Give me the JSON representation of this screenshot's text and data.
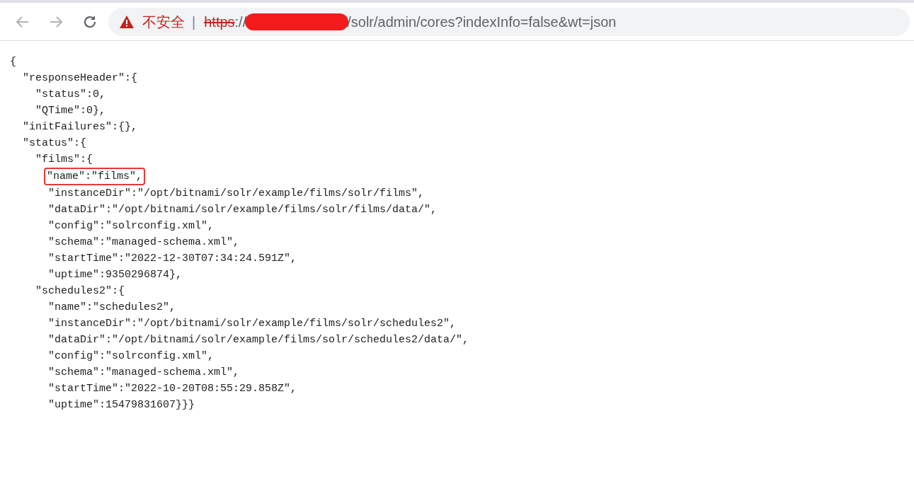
{
  "toolbar": {
    "security_label": "不安全",
    "separator": "|",
    "url": {
      "scheme": "https",
      "scheme_insecure": true,
      "delimiter": "://",
      "redacted": true,
      "path": "/solr/admin/cores?indexInfo=false&wt=json"
    }
  },
  "document": {
    "lines": [
      {
        "text": "{",
        "highlighted": false,
        "children": [
          {
            "text": "\"responseHeader\":{",
            "highlighted": false,
            "children": [
              {
                "text": "\"status\":0,",
                "highlighted": false
              },
              {
                "text": "\"QTime\":0},",
                "highlighted": false
              }
            ]
          },
          {
            "text": "\"initFailures\":{},",
            "highlighted": false
          },
          {
            "text": "\"status\":{",
            "highlighted": false,
            "children": [
              {
                "text": "\"films\":{",
                "highlighted": false,
                "children": [
                  {
                    "text": "\"name\":\"films\",",
                    "highlighted": true
                  },
                  {
                    "text": "\"instanceDir\":\"/opt/bitnami/solr/example/films/solr/films\",",
                    "highlighted": false
                  },
                  {
                    "text": "\"dataDir\":\"/opt/bitnami/solr/example/films/solr/films/data/\",",
                    "highlighted": false
                  },
                  {
                    "text": "\"config\":\"solrconfig.xml\",",
                    "highlighted": false
                  },
                  {
                    "text": "\"schema\":\"managed-schema.xml\",",
                    "highlighted": false
                  },
                  {
                    "text": "\"startTime\":\"2022-12-30T07:34:24.591Z\",",
                    "highlighted": false
                  },
                  {
                    "text": "\"uptime\":9350296874},",
                    "highlighted": false
                  }
                ]
              },
              {
                "text": "\"schedules2\":{",
                "highlighted": false,
                "children": [
                  {
                    "text": "\"name\":\"schedules2\",",
                    "highlighted": false
                  },
                  {
                    "text": "\"instanceDir\":\"/opt/bitnami/solr/example/films/solr/schedules2\",",
                    "highlighted": false
                  },
                  {
                    "text": "\"dataDir\":\"/opt/bitnami/solr/example/films/solr/schedules2/data/\",",
                    "highlighted": false
                  },
                  {
                    "text": "\"config\":\"solrconfig.xml\",",
                    "highlighted": false
                  },
                  {
                    "text": "\"schema\":\"managed-schema.xml\",",
                    "highlighted": false
                  },
                  {
                    "text": "\"startTime\":\"2022-10-20T08:55:29.858Z\",",
                    "highlighted": false
                  },
                  {
                    "text": "\"uptime\":15479831607}}}",
                    "highlighted": false
                  }
                ]
              }
            ]
          }
        ]
      }
    ]
  }
}
